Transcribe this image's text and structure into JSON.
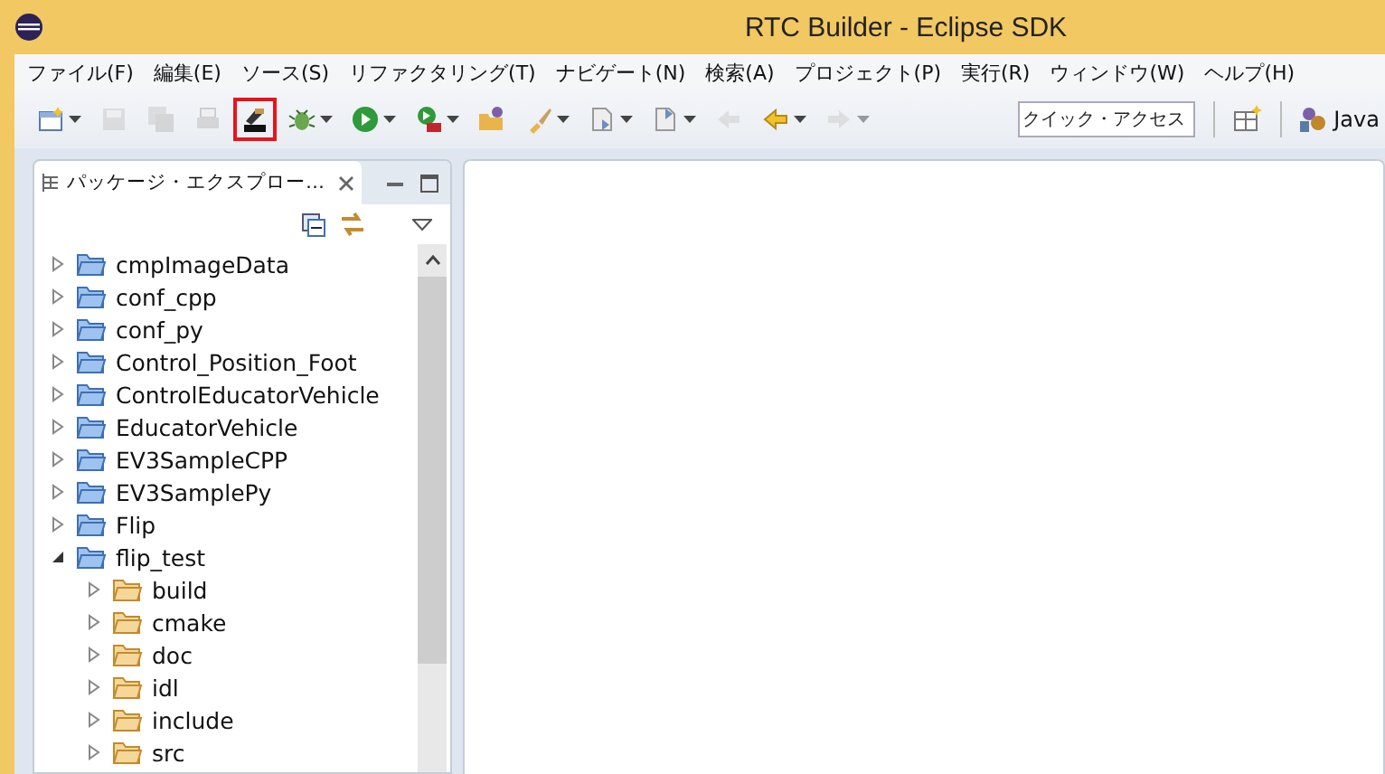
{
  "window": {
    "title": "RTC Builder - Eclipse SDK"
  },
  "menu": [
    {
      "label": "ファイル(F)"
    },
    {
      "label": "編集(E)"
    },
    {
      "label": "ソース(S)"
    },
    {
      "label": "リファクタリング(T)"
    },
    {
      "label": "ナビゲート(N)"
    },
    {
      "label": "検索(A)"
    },
    {
      "label": "プロジェクト(P)"
    },
    {
      "label": "実行(R)"
    },
    {
      "label": "ウィンドウ(W)"
    },
    {
      "label": "ヘルプ(H)"
    }
  ],
  "toolbar": {
    "buttons": [
      {
        "kind": "new",
        "dropdown": true,
        "disabled": false,
        "highlighted": false
      },
      {
        "kind": "save",
        "dropdown": false,
        "disabled": true,
        "highlighted": false
      },
      {
        "kind": "saveall",
        "dropdown": false,
        "disabled": true,
        "highlighted": false
      },
      {
        "kind": "print",
        "dropdown": false,
        "disabled": true,
        "highlighted": false
      },
      {
        "kind": "rtc",
        "dropdown": false,
        "disabled": false,
        "highlighted": true
      },
      {
        "kind": "debug",
        "dropdown": true,
        "disabled": false,
        "highlighted": false
      },
      {
        "kind": "run",
        "dropdown": true,
        "disabled": false,
        "highlighted": false
      },
      {
        "kind": "external",
        "dropdown": true,
        "disabled": false,
        "highlighted": false
      },
      {
        "kind": "openfolder",
        "dropdown": false,
        "disabled": false,
        "highlighted": false
      },
      {
        "kind": "brush",
        "dropdown": true,
        "disabled": false,
        "highlighted": false
      },
      {
        "kind": "nextannot",
        "dropdown": true,
        "disabled": false,
        "highlighted": false
      },
      {
        "kind": "prevannot",
        "dropdown": true,
        "disabled": false,
        "highlighted": false
      },
      {
        "kind": "lastedit",
        "dropdown": false,
        "disabled": true,
        "highlighted": false
      },
      {
        "kind": "back",
        "dropdown": true,
        "disabled": false,
        "highlighted": false
      },
      {
        "kind": "forward",
        "dropdown": true,
        "disabled": true,
        "highlighted": false
      }
    ],
    "quick_access": {
      "placeholder": "クイック・アクセス"
    },
    "perspective": {
      "label": "Java"
    }
  },
  "explorer": {
    "tab": {
      "label": "パッケージ・エクスプロー…",
      "selected": true
    },
    "tree": [
      {
        "label": "cmpImageData",
        "kind": "project",
        "expanded": false
      },
      {
        "label": "conf_cpp",
        "kind": "project",
        "expanded": false
      },
      {
        "label": "conf_py",
        "kind": "project",
        "expanded": false
      },
      {
        "label": "Control_Position_Foot",
        "kind": "project",
        "expanded": false
      },
      {
        "label": "ControlEducatorVehicle",
        "kind": "project",
        "expanded": false
      },
      {
        "label": "EducatorVehicle",
        "kind": "project",
        "expanded": false
      },
      {
        "label": "EV3SampleCPP",
        "kind": "project",
        "expanded": false
      },
      {
        "label": "EV3SamplePy",
        "kind": "project",
        "expanded": false
      },
      {
        "label": "Flip",
        "kind": "project",
        "expanded": false
      },
      {
        "label": "flip_test",
        "kind": "project",
        "expanded": true,
        "children": [
          {
            "label": "build",
            "kind": "folder",
            "expanded": false
          },
          {
            "label": "cmake",
            "kind": "folder",
            "expanded": false
          },
          {
            "label": "doc",
            "kind": "folder",
            "expanded": false
          },
          {
            "label": "idl",
            "kind": "folder",
            "expanded": false
          },
          {
            "label": "include",
            "kind": "folder",
            "expanded": false
          },
          {
            "label": "src",
            "kind": "folder",
            "expanded": false
          }
        ]
      }
    ]
  }
}
